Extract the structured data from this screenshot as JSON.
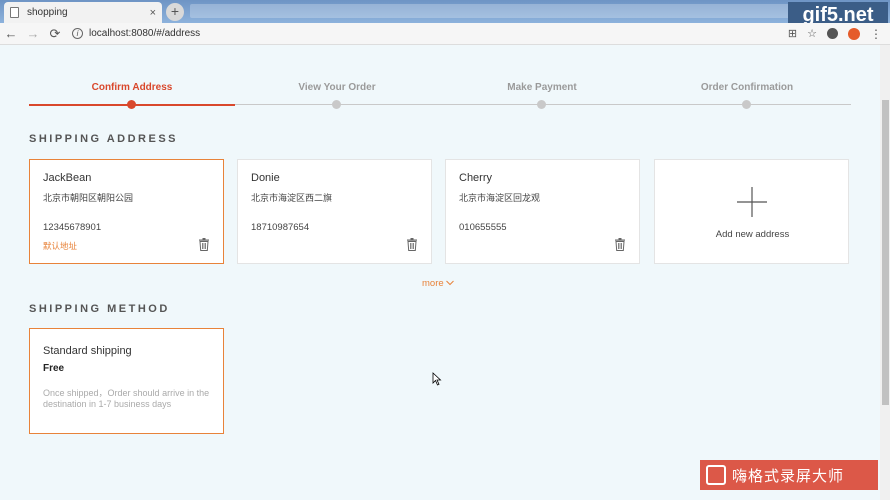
{
  "browser": {
    "tab_title": "shopping",
    "tab_close": "×",
    "new_tab": "+",
    "url": "localhost:8080/#/address",
    "nav": {
      "back": "←",
      "forward": "→",
      "reload": "⟳"
    },
    "icons": {
      "translate": "⊞",
      "star": "☆",
      "menu": "⋮"
    }
  },
  "steps": [
    {
      "label": "Confirm Address",
      "active": true
    },
    {
      "label": "View Your Order",
      "active": false
    },
    {
      "label": "Make Payment",
      "active": false
    },
    {
      "label": "Order Confirmation",
      "active": false
    }
  ],
  "shipping_address": {
    "title": "SHIPPING ADDRESS",
    "addresses": [
      {
        "name": "JackBean",
        "street": "北京市朝阳区朝阳公园",
        "phone": "12345678901",
        "default_label": "默认地址",
        "selected": true
      },
      {
        "name": "Donie",
        "street": "北京市海淀区西二旗",
        "phone": "18710987654",
        "default_label": "",
        "selected": false
      },
      {
        "name": "Cherry",
        "street": "北京市海淀区回龙观",
        "phone": "010655555",
        "default_label": "",
        "selected": false
      }
    ],
    "add_new_label": "Add new address",
    "more_label": "more"
  },
  "shipping_method": {
    "title": "SHIPPING METHOD",
    "name": "Standard shipping",
    "price": "Free",
    "description": "Once shipped，Order should arrive in the destination in 1-7 business days"
  },
  "watermarks": {
    "top": "gif5.net",
    "bottom": "嗨格式录屏大师"
  },
  "colors": {
    "accent_red": "#d9482c",
    "accent_orange": "#e8833a",
    "page_bg": "#f0f8fb"
  }
}
